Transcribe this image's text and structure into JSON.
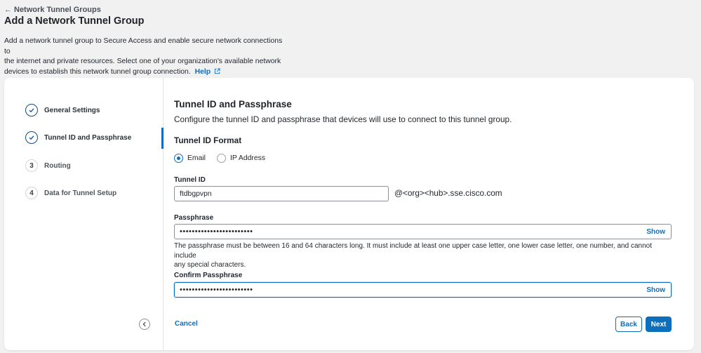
{
  "breadcrumb": {
    "back_label": "Network Tunnel Groups"
  },
  "page": {
    "title": "Add a Network Tunnel Group",
    "intro_line1": "Add a network tunnel group to Secure Access and enable secure network connections to",
    "intro_line2": "the internet and private resources. Select one of your organization's available network",
    "intro_line3": "devices to establish this network tunnel group connection.",
    "help_label": "Help"
  },
  "stepper": {
    "steps": [
      {
        "label": "General Settings",
        "status": "complete",
        "icon": "check-icon"
      },
      {
        "label": "Tunnel ID and Passphrase",
        "status": "complete",
        "icon": "check-icon"
      },
      {
        "label": "Routing",
        "status": "pending",
        "number": "3"
      },
      {
        "label": "Data for Tunnel Setup",
        "status": "pending",
        "number": "4"
      }
    ],
    "active_index": 1
  },
  "form": {
    "section_title": "Tunnel ID and Passphrase",
    "section_desc": "Configure the tunnel ID and passphrase that devices will use to connect to this tunnel group.",
    "format_title": "Tunnel ID Format",
    "format_options": [
      {
        "label": "Email",
        "selected": true
      },
      {
        "label": "IP Address",
        "selected": false
      }
    ],
    "tunnel_id": {
      "label": "Tunnel ID",
      "value": "ftdbgpvpn",
      "suffix": "@<org><hub>.sse.cisco.com"
    },
    "passphrase": {
      "label": "Passphrase",
      "masked_value": "••••••••••••••••••••••••",
      "show_label": "Show",
      "hint_line1": "The passphrase must be between 16 and 64 characters long. It must include at least one upper case letter, one lower case letter, one number, and cannot include",
      "hint_line2": "any special characters."
    },
    "confirm_passphrase": {
      "label": "Confirm Passphrase",
      "masked_value": "••••••••••••••••••••••••",
      "show_label": "Show"
    }
  },
  "footer": {
    "cancel_label": "Cancel",
    "back_label": "Back",
    "next_label": "Next"
  },
  "colors": {
    "accent": "#0d6ebc",
    "step_done": "#0d4e8c",
    "background": "#f1f1f2"
  }
}
